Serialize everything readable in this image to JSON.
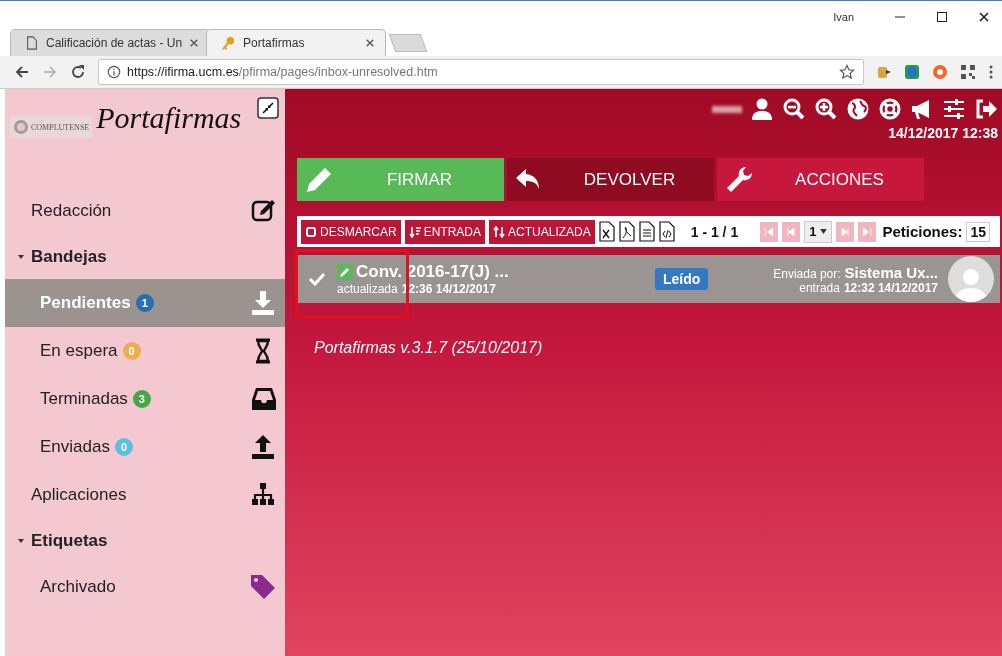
{
  "browser": {
    "tabs": [
      {
        "title": "Calificación de actas - Un",
        "selected": false
      },
      {
        "title": "Portafirmas",
        "selected": true
      }
    ],
    "profile": "Ivan",
    "url": {
      "origin": "https://ifirma.ucm.es",
      "path": "/pfirma/pages/inbox-unresolved.htm"
    }
  },
  "sidebar": {
    "logo_text": "COMPLUTENSE",
    "app_name": "Portafirmas",
    "items": [
      {
        "kind": "link",
        "label": "Redacción"
      },
      {
        "kind": "section",
        "label": "Bandejas",
        "expanded": true,
        "children": [
          {
            "label": "Pendientes",
            "badge": "1",
            "color": "#2a6db0",
            "selected": true
          },
          {
            "label": "En espera",
            "badge": "0",
            "color": "#f0ad4e",
            "selected": false
          },
          {
            "label": "Terminadas",
            "badge": "3",
            "color": "#45a845",
            "selected": false
          },
          {
            "label": "Enviadas",
            "badge": "0",
            "color": "#5bc0de",
            "selected": false
          }
        ]
      },
      {
        "kind": "link",
        "label": "Aplicaciones"
      },
      {
        "kind": "section",
        "label": "Etiquetas",
        "expanded": true,
        "children": [
          {
            "label": "Archivado",
            "color": "#8a2a8e",
            "selected": false
          }
        ]
      }
    ]
  },
  "header": {
    "datetime": "14/12/2017 12:38"
  },
  "actions": [
    {
      "label": "FIRMAR",
      "color": "#58b957"
    },
    {
      "label": "DEVOLVER",
      "color": "#8e0b22"
    },
    {
      "label": "ACCIONES",
      "color": "#c8173c"
    }
  ],
  "toolbar": {
    "buttons": [
      "DESMARCAR",
      "ENTRADA",
      "ACTUALIZADA"
    ],
    "range": "1 - 1 / 1",
    "pager": [
      {
        "kind": "first",
        "disabled": true
      },
      {
        "kind": "prev",
        "disabled": true
      },
      {
        "kind": "page",
        "value": "1"
      },
      {
        "kind": "next",
        "disabled": true
      },
      {
        "kind": "last",
        "disabled": true
      }
    ],
    "count_label": "Peticiones:",
    "count": "15"
  },
  "requests": [
    {
      "checked": true,
      "title": "Conv. 2016-17(J) ...",
      "updated_label": "actualizada",
      "updated": "12:36 14/12/2017",
      "status": "Leído",
      "sender_label": "Enviada por:",
      "sender": "Sistema Ux...",
      "received_label": "entrada",
      "received": "12:32 14/12/2017"
    }
  ],
  "version": "Portafirmas v.3.1.7 (25/10/2017)"
}
